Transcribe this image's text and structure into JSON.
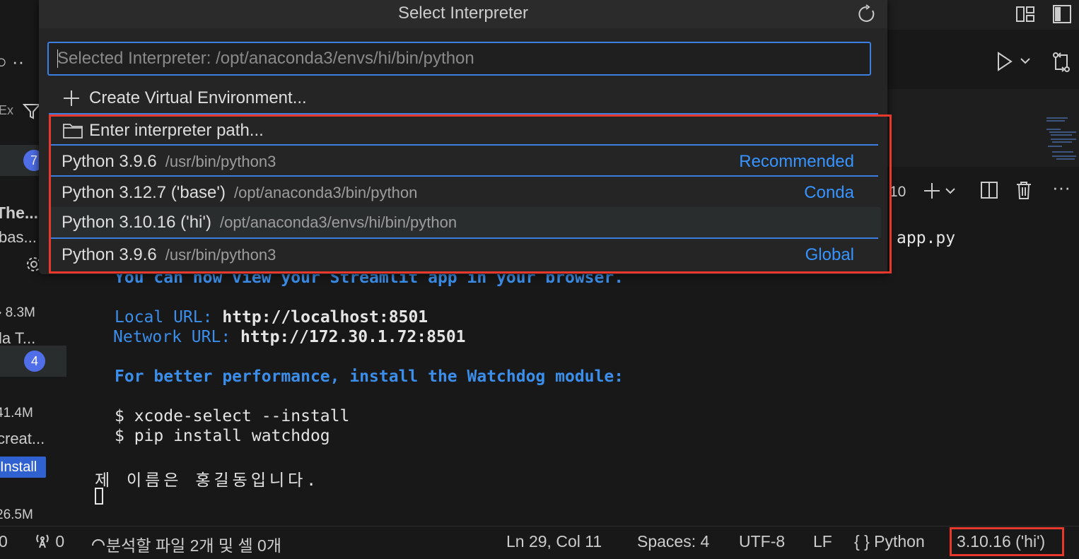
{
  "quick_pick": {
    "title": "Select Interpreter",
    "input_placeholder": "Selected Interpreter: /opt/anaconda3/envs/hi/bin/python",
    "create_env_label": "Create Virtual Environment...",
    "enter_path_label": "Enter interpreter path...",
    "items": [
      {
        "label": "Python 3.9.6",
        "path": "/usr/bin/python3",
        "tag": "Recommended"
      },
      {
        "label": "Python 3.12.7 ('base')",
        "path": "/opt/anaconda3/bin/python",
        "tag": "Conda"
      },
      {
        "label": "Python 3.10.16 ('hi')",
        "path": "/opt/anaconda3/envs/hi/bin/python",
        "tag": ""
      },
      {
        "label": "Python 3.9.6",
        "path": "/usr/bin/python3",
        "tag": "Global"
      }
    ]
  },
  "sidebar": {
    "badge_top": "7",
    "ext_title": "The...",
    "ext_sub": "bas...",
    "size_1": "8.3M",
    "ext2_title": "la T...",
    "badge_mid": "4",
    "size_2": "41.4M",
    "ext3_title": "creat...",
    "install_label": "Install",
    "size_3": "26.5M",
    "filter_prefix": "Ex"
  },
  "panel": {
    "header_fragment": "10",
    "file_fragment": "app.py",
    "terminal_lines": {
      "line1": "You can now view your Streamlit app in your browser.",
      "local_label": "Local URL:",
      "local_url": "http://localhost:8501",
      "network_label": "Network URL:",
      "network_url": "http://172.30.1.72:8501",
      "perf": "For better performance, install the Watchdog module:",
      "cmd1": "$ xcode-select --install",
      "cmd2": "$ pip install watchdog",
      "output": "제 이름은 홍길동입니다."
    }
  },
  "status_bar": {
    "errors": "0",
    "ports": "0",
    "analysis": "분석할 파일 2개 및 셀 0개",
    "position": "Ln 29, Col 11",
    "spaces": "Spaces: 4",
    "encoding": "UTF-8",
    "eol": "LF",
    "language": "Python",
    "interpreter": "3.10.16 ('hi')"
  },
  "colors": {
    "accent": "#3c7fe0",
    "highlight": "#e8372b",
    "link": "#3794ff"
  }
}
